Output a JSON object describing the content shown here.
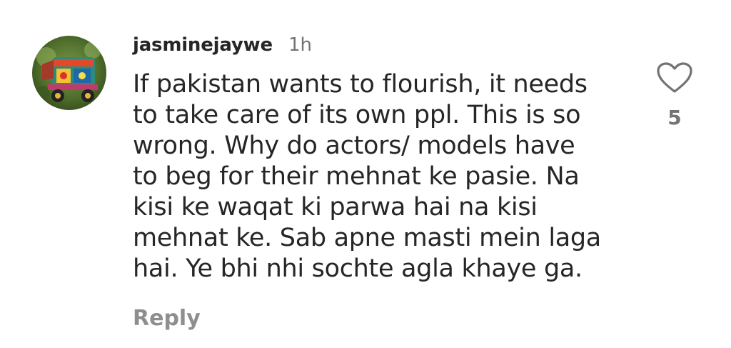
{
  "comment": {
    "username": "jasminejaywe",
    "timestamp": "1h",
    "text_lines": [
      "If pakistan wants to flourish, it needs",
      "to take care of its own ppl. This is so",
      "wrong. Why do actors/ models have",
      "to beg for their mehnat ke pasie. Na",
      "kisi ke waqat ki parwa hai na kisi",
      "mehnat ke. Sab apne masti mein laga",
      "hai. Ye bhi nhi sochte agla khaye ga."
    ],
    "reply_label": "Reply",
    "like_count": "5",
    "like_icon": "heart-outline-icon"
  },
  "colors": {
    "text_primary": "#262626",
    "text_secondary": "#737373",
    "reply": "#8e8e8e",
    "background": "#ffffff"
  }
}
